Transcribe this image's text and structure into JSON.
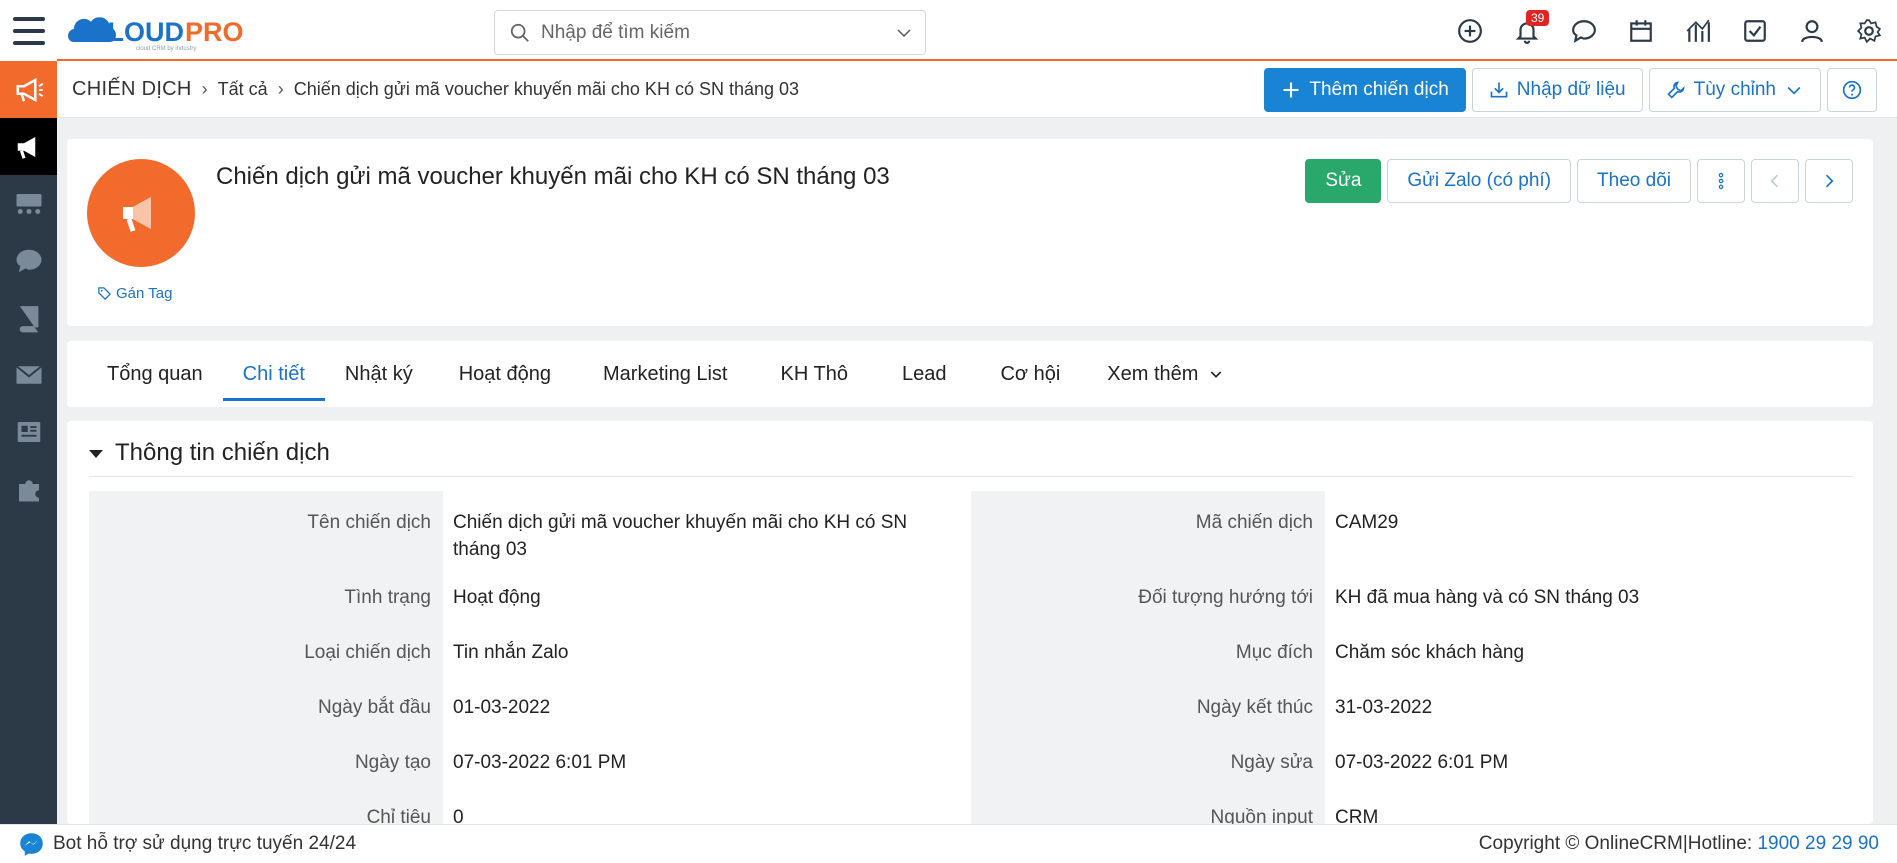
{
  "logo": {
    "text": "CLOUDPRO",
    "tagline": "cloud CRM by industry"
  },
  "search": {
    "placeholder": "Nhập để tìm kiếm"
  },
  "header_icons": {
    "notifications_count": "39"
  },
  "breadcrumb": {
    "module": "CHIẾN DỊCH",
    "filter": "Tất cả",
    "record": "Chiến dịch gửi mã voucher khuyến mãi cho KH có SN tháng 03"
  },
  "actions": {
    "add": "Thêm chiến dịch",
    "import": "Nhập dữ liệu",
    "customize": "Tùy chỉnh"
  },
  "record": {
    "title": "Chiến dịch gửi mã voucher khuyến mãi cho KH có SN tháng 03",
    "tag_label": "Gán Tag",
    "btn_edit": "Sửa",
    "btn_zalo": "Gửi Zalo (có phí)",
    "btn_follow": "Theo dõi"
  },
  "tabs": [
    "Tổng quan",
    "Chi tiết",
    "Nhật ký",
    "Hoạt động",
    "Marketing List",
    "KH Thô",
    "Lead",
    "Cơ hội",
    "Xem thêm"
  ],
  "section": {
    "title": "Thông tin chiến dịch",
    "rows": [
      {
        "l1": "Tên chiến dịch",
        "v1": "Chiến dịch gửi mã voucher khuyến mãi cho KH có SN tháng 03",
        "l2": "Mã chiến dịch",
        "v2": "CAM29"
      },
      {
        "l1": "Tình trạng",
        "v1": "Hoạt động",
        "l2": "Đối tượng hướng tới",
        "v2": "KH đã mua hàng và có SN tháng 03"
      },
      {
        "l1": "Loại chiến dịch",
        "v1": "Tin nhắn Zalo",
        "l2": "Mục đích",
        "v2": "Chăm sóc khách hàng"
      },
      {
        "l1": "Ngày bắt đầu",
        "v1": "01-03-2022",
        "l2": "Ngày kết thúc",
        "v2": "31-03-2022"
      },
      {
        "l1": "Ngày tạo",
        "v1": "07-03-2022 6:01 PM",
        "l2": "Ngày sửa",
        "v2": "07-03-2022 6:01 PM"
      },
      {
        "l1": "Chỉ tiêu",
        "v1": "0",
        "l2": "Nguồn input",
        "v2": "CRM"
      }
    ]
  },
  "footer": {
    "bot": "Bot hỗ trợ sử dụng trực tuyến 24/24",
    "copyright": "Copyright © OnlineCRM|Hotline: ",
    "hotline": "1900 29 29 90"
  },
  "colors": {
    "brand_orange": "#f26b2c",
    "brand_blue": "#1a84d4",
    "sidebar": "#2b3a46",
    "success": "#28a86b"
  }
}
